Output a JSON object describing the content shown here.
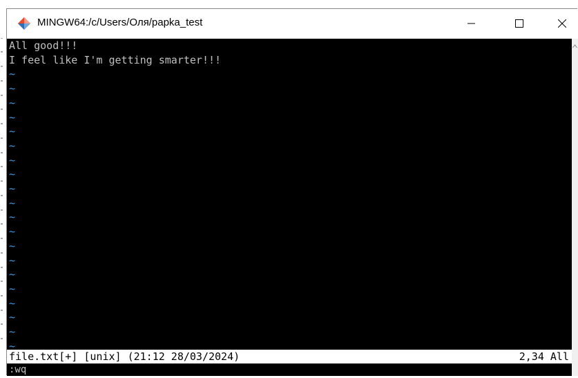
{
  "window": {
    "title": "MINGW64:/c/Users/Оля/papka_test",
    "icons": {
      "app": "git-bash-diamond-icon",
      "minimize": "minimize-icon",
      "maximize": "maximize-icon",
      "close": "close-icon"
    }
  },
  "terminal": {
    "lines": [
      "All good!!!",
      "I feel like I'm getting smarter!!!",
      "~",
      "~",
      "~",
      "~",
      "~",
      "~",
      "~",
      "~",
      "~",
      "~",
      "~",
      "~",
      "~",
      "~",
      "~",
      "~",
      "~",
      "~",
      "~",
      "~"
    ],
    "status": {
      "left": "file.txt[+] [unix] (21:12 28/03/2024)",
      "right": "2,34 All"
    },
    "command": ":wq"
  },
  "colors": {
    "background": "#000000",
    "text": "#c0c0c0",
    "tilde": "#3a96dd",
    "status_bg": "#ffffff"
  }
}
